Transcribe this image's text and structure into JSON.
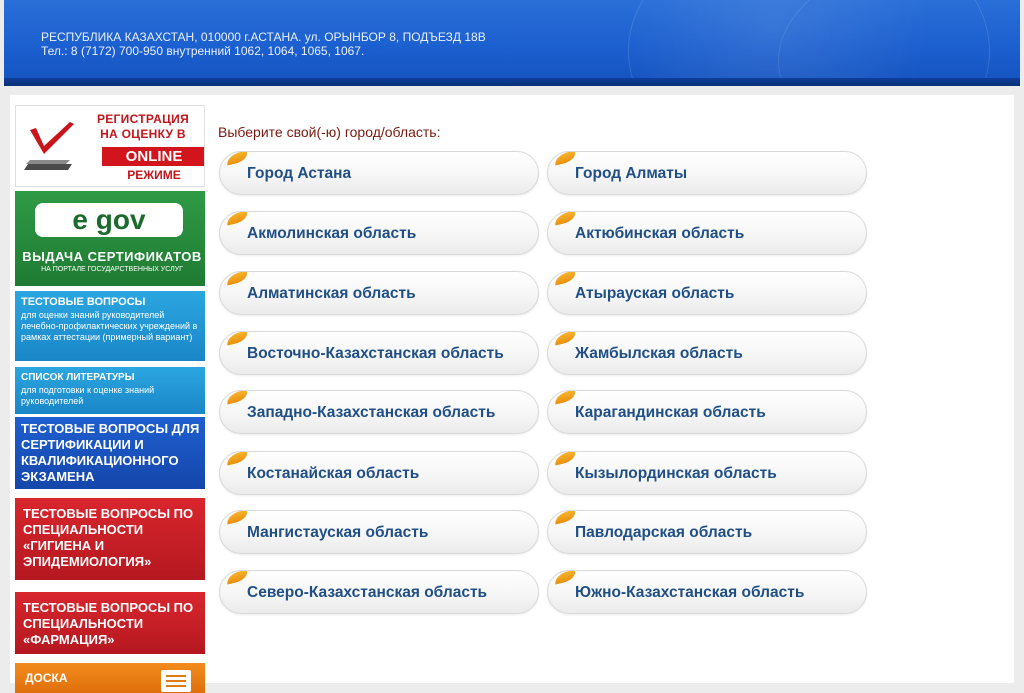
{
  "header": {
    "address_line": "РЕСПУБЛИКА КАЗАХСТАН, 010000 г.АСТАНА. ул. ОРЫНБОР 8, ПОДЪЕЗД 18В",
    "phone_line": "Тел.: 8 (7172) 700-950 внутренний 1062, 1064, 1065, 1067."
  },
  "sidebar": {
    "registration": {
      "line1": "РЕГИСТРАЦИЯ",
      "line2": "НА ОЦЕНКУ В",
      "online": "ONLINE",
      "mode": "РЕЖИМЕ"
    },
    "egov": {
      "logo": "e gov",
      "title": "ВЫДАЧА СЕРТИФИКАТОВ",
      "subtitle": "НА ПОРТАЛЕ ГОСУДАРСТВЕННЫХ УСЛУГ"
    },
    "test_questions": {
      "title": "ТЕСТОВЫЕ ВОПРОСЫ",
      "subtitle": "для оценки знаний руководителей лечебно-профилактических учреждений в рамках аттестации (примерный вариант)"
    },
    "literature": {
      "title": "СПИСОК ЛИТЕРАТУРЫ",
      "subtitle": "для подготовки к оценке знаний руководителей"
    },
    "certification": {
      "title": "ТЕСТОВЫЕ ВОПРОСЫ ДЛЯ СЕРТИФИКАЦИИ И КВАЛИФИКАЦИОННОГО ЭКЗАМЕНА"
    },
    "hygiene": {
      "title": "ТЕСТОВЫЕ ВОПРОСЫ ПО СПЕЦИАЛЬНОСТИ «ГИГИЕНА И ЭПИДЕМИОЛОГИЯ»"
    },
    "pharmacy": {
      "title": "ТЕСТОВЫЕ ВОПРОСЫ ПО СПЕЦИАЛЬНОСТИ «ФАРМАЦИЯ»"
    },
    "board": {
      "title": "ДОСКА"
    }
  },
  "main": {
    "prompt": "Выберите свой(-ю) город/область:",
    "regions_left": [
      "Город Астана",
      "Акмолинская область",
      "Алматинская область",
      "Восточно-Казахстанская область",
      "Западно-Казахстанская область",
      "Костанайская область",
      "Мангистауская область",
      "Северо-Казахстанская область"
    ],
    "regions_right": [
      "Город Алматы",
      "Актюбинская область",
      "Атырауская область",
      "Жамбылская область",
      "Карагандинская область",
      "Кызылординская область",
      "Павлодарская область",
      "Южно-Казахстанская область"
    ]
  },
  "colors": {
    "header_blue": "#1c5fcf",
    "label_blue": "#1f4f86",
    "leaf_orange": "#f0a21e",
    "prompt_red": "#7a1a10"
  }
}
